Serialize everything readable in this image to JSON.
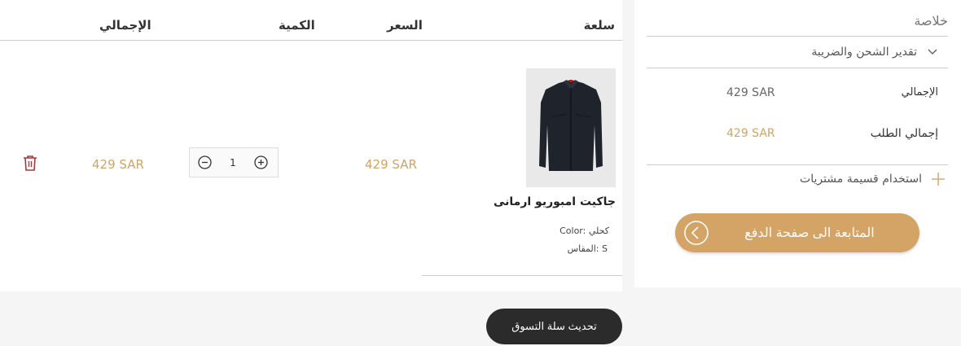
{
  "cart": {
    "headers": {
      "item": "سلعة",
      "price": "السعر",
      "quantity": "الكمية",
      "total": "الإجمالي"
    },
    "item": {
      "name": "جاكيت امبوريو ارمانى",
      "options": [
        {
          "label": "Color:",
          "value": "كحلي"
        },
        {
          "label": "المقاس:",
          "value": "S"
        }
      ],
      "price": "429 SAR",
      "quantity": "1",
      "line_total": "429 SAR"
    },
    "update_button": "تحديث سلة التسوق"
  },
  "summary": {
    "title": "خلاصة",
    "shipping_estimate": "تقدير الشحن والضريبة",
    "subtotal_label": "الإجمالي",
    "subtotal_value": "429 SAR",
    "order_total_label": "إجمالي الطلب",
    "order_total_value": "429 SAR",
    "coupon_label": "استخدام قسيمة مشتريات",
    "checkout_button": "المتابعة الى صفحة الدفع"
  }
}
